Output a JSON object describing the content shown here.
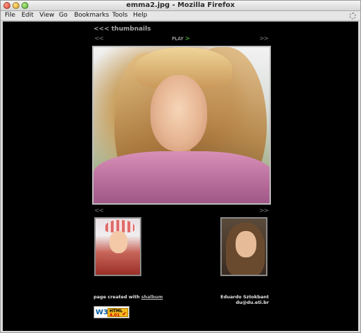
{
  "window": {
    "title": "emma2.jpg - Mozilla Firefox"
  },
  "menu": {
    "items": [
      "File",
      "Edit",
      "View",
      "Go",
      "Bookmarks",
      "Tools",
      "Help"
    ]
  },
  "gallery": {
    "thumbnails_link": "<<< thumbnails",
    "prev_label": "<<",
    "next_label": ">>",
    "play_label": "PLAY",
    "play_arrow": ">",
    "main_image_alt": "emma2.jpg"
  },
  "footer": {
    "created_with_prefix": "page created with",
    "created_with_link": "shalbum",
    "author_name": "Eduardo Sztokbant",
    "author_email": "du@du.eti.br"
  },
  "badge": {
    "logo": "W3C",
    "line1": "HTML",
    "line2": "4.01",
    "check": "✔"
  },
  "colors": {
    "background": "#000000",
    "play_arrow": "#5acc3a",
    "link": "#bdbdbd"
  }
}
